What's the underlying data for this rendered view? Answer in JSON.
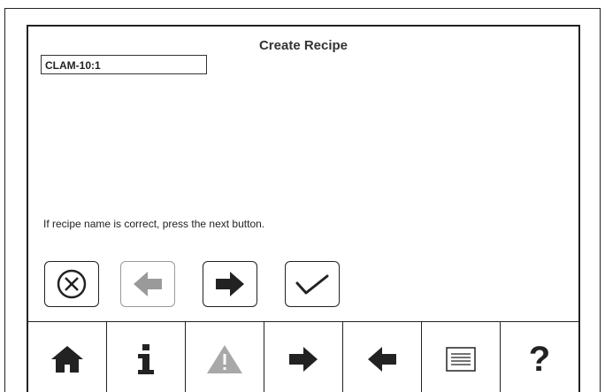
{
  "screen": {
    "title": "Create Recipe",
    "recipe_name": "CLAM-10:1",
    "instruction": "If recipe name is correct, press the next button."
  },
  "action_buttons": [
    {
      "icon": "cancel-icon",
      "enabled": true
    },
    {
      "icon": "back-arrow-icon",
      "enabled": false
    },
    {
      "icon": "next-arrow-icon",
      "enabled": true
    },
    {
      "icon": "checkmark-icon",
      "enabled": true
    }
  ],
  "toolbar": [
    {
      "icon": "home-icon",
      "enabled": true
    },
    {
      "icon": "info-icon",
      "enabled": true
    },
    {
      "icon": "warning-icon",
      "enabled": false
    },
    {
      "icon": "forward-arrow-icon",
      "enabled": true
    },
    {
      "icon": "back-arrow-icon",
      "enabled": true
    },
    {
      "icon": "list-icon",
      "enabled": true
    },
    {
      "icon": "help-icon",
      "label": "?",
      "enabled": true
    }
  ],
  "colors": {
    "ink": "#222222",
    "disabled": "#9a9a9a",
    "background": "#ffffff"
  }
}
